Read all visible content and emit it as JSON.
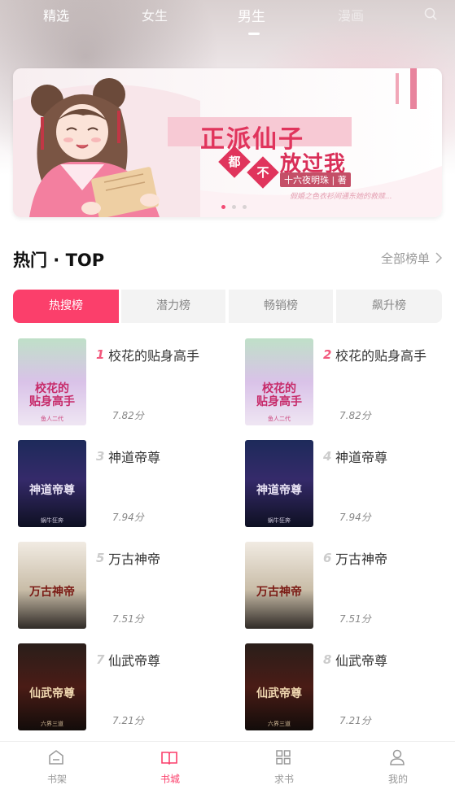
{
  "top_tabs": [
    "精选",
    "女生",
    "男生",
    "漫画"
  ],
  "banner": {
    "title_line1": "正派仙子",
    "title_char1": "都",
    "title_char2": "不",
    "title_line2": "放过我",
    "author": "十六夜明珠 | 著",
    "subtitle": "假婚之色衣衫间通东她的救赎..."
  },
  "section": {
    "title": "热门 · TOP",
    "more": "全部榜单"
  },
  "rank_tabs": [
    "热搜榜",
    "潜力榜",
    "畅销榜",
    "飙升榜"
  ],
  "books": [
    {
      "rank": "1",
      "title": "校花的贴身高手",
      "score": "7.82分",
      "cover_text": "校花的\n贴身高手",
      "cover_author": "鱼人二代"
    },
    {
      "rank": "2",
      "title": "校花的贴身高手",
      "score": "7.82分",
      "cover_text": "校花的\n贴身高手",
      "cover_author": "鱼人二代"
    },
    {
      "rank": "3",
      "title": "神道帝尊",
      "score": "7.94分",
      "cover_text": "神道帝尊",
      "cover_author": "蜗牛狂奔"
    },
    {
      "rank": "4",
      "title": "神道帝尊",
      "score": "7.94分",
      "cover_text": "神道帝尊",
      "cover_author": "蜗牛狂奔"
    },
    {
      "rank": "5",
      "title": "万古神帝",
      "score": "7.51分",
      "cover_text": "万古神帝",
      "cover_author": ""
    },
    {
      "rank": "6",
      "title": "万古神帝",
      "score": "7.51分",
      "cover_text": "万古神帝",
      "cover_author": ""
    },
    {
      "rank": "7",
      "title": "仙武帝尊",
      "score": "7.21分",
      "cover_text": "仙武帝尊",
      "cover_author": "六界三道"
    },
    {
      "rank": "8",
      "title": "仙武帝尊",
      "score": "7.21分",
      "cover_text": "仙武帝尊",
      "cover_author": "六界三道"
    }
  ],
  "bottom_nav": [
    "书架",
    "书城",
    "求书",
    "我的"
  ],
  "colors": {
    "accent": "#fb3f6b",
    "rank_top": "#f2587c",
    "rank_other": "#cccccc"
  }
}
